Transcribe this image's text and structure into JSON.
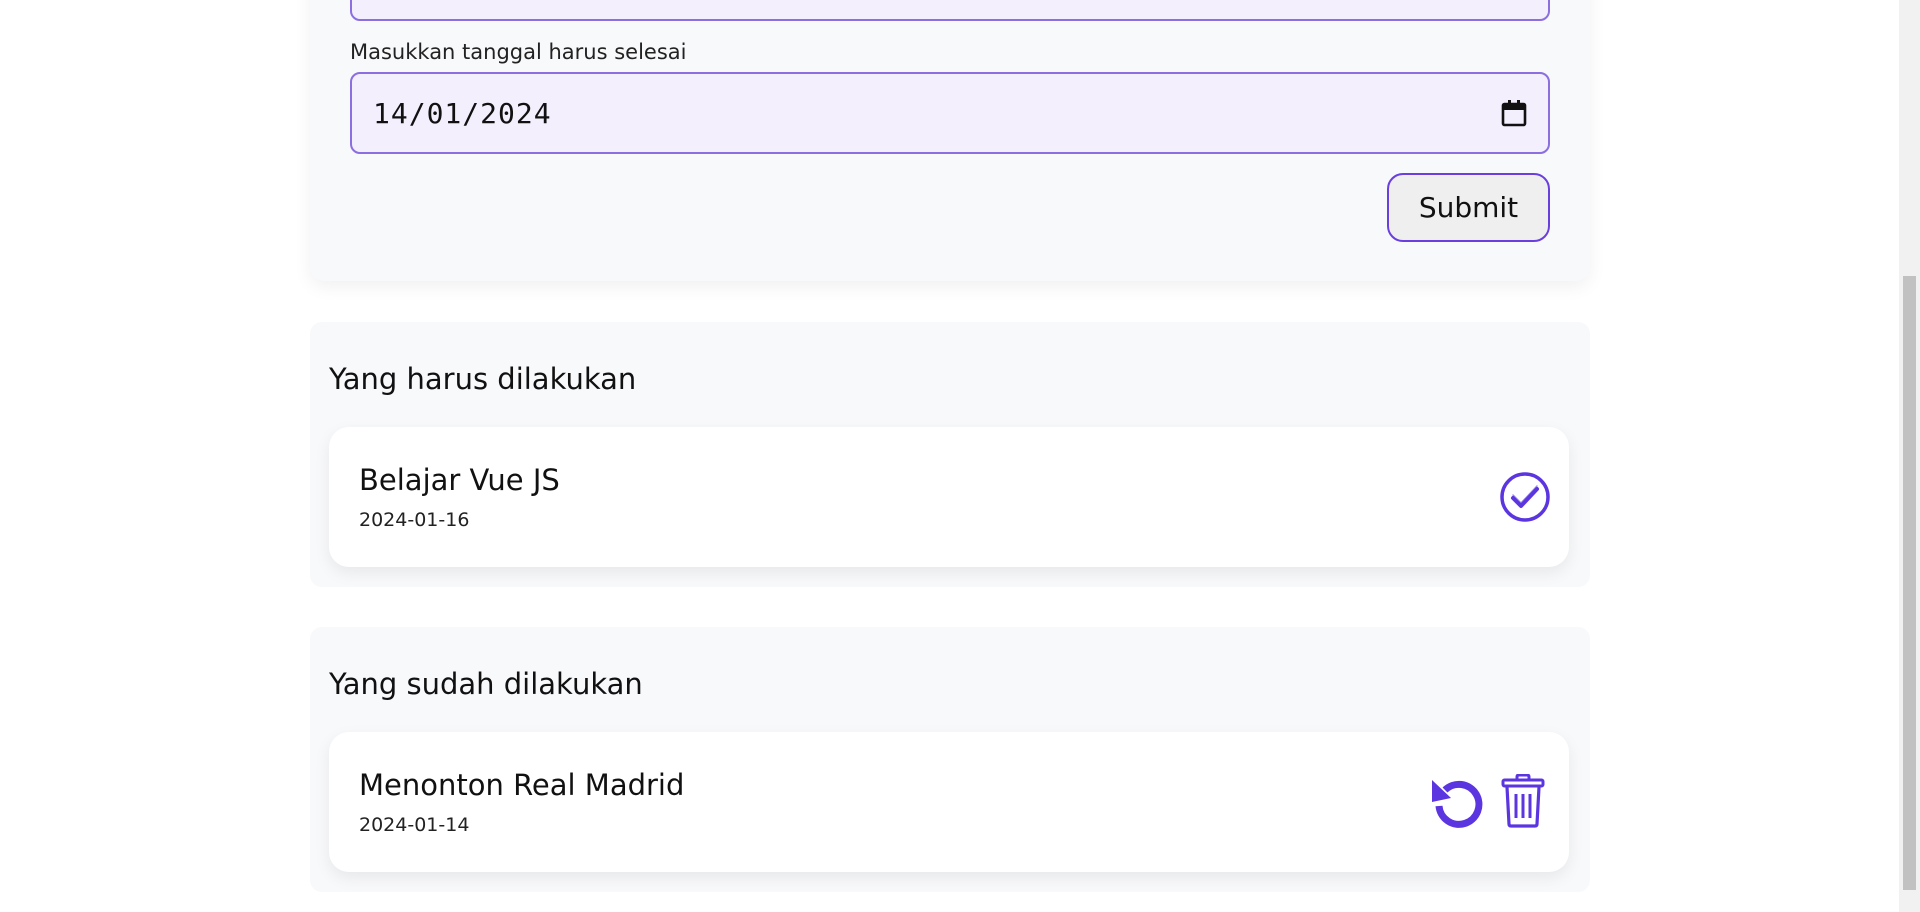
{
  "form": {
    "date_label": "Masukkan tanggal harus selesai",
    "date_value": "14/01/2024",
    "submit_label": "Submit"
  },
  "todo_section": {
    "title": "Yang harus dilakukan",
    "items": [
      {
        "title": "Belajar Vue JS",
        "date": "2024-01-16"
      }
    ]
  },
  "done_section": {
    "title": "Yang sudah dilakukan",
    "items": [
      {
        "title": "Menonton Real Madrid",
        "date": "2024-01-14"
      }
    ]
  },
  "icons": {
    "calendar": "calendar-icon",
    "check": "check-circle-icon",
    "undo": "undo-icon",
    "delete": "trash-icon"
  },
  "colors": {
    "accent": "#5b36e0",
    "input_bg": "#f3effd",
    "input_border": "#8b6ee0",
    "card_bg": "#ffffff",
    "section_bg": "#f8f9fb"
  }
}
